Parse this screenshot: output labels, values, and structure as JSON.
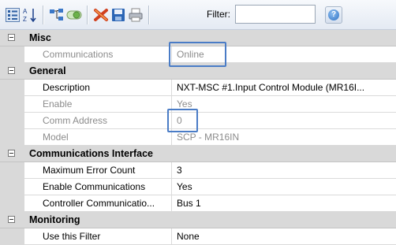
{
  "toolbar": {
    "filter_label": "Filter:",
    "filter_value": "",
    "sort_icon_text": "AZ"
  },
  "grid": {
    "categories": [
      {
        "label": "Misc",
        "properties": [
          {
            "name": "Communications",
            "value": "Online",
            "readonly": true
          }
        ]
      },
      {
        "label": "General",
        "properties": [
          {
            "name": "Description",
            "value": "NXT-MSC #1.Input Control Module (MR16I...",
            "readonly": false
          },
          {
            "name": "Enable",
            "value": "Yes",
            "readonly": true
          },
          {
            "name": "Comm Address",
            "value": "0",
            "readonly": true
          },
          {
            "name": "Model",
            "value": "SCP - MR16IN",
            "readonly": true
          }
        ]
      },
      {
        "label": "Communications Interface",
        "properties": [
          {
            "name": "Maximum Error Count",
            "value": "3",
            "readonly": false
          },
          {
            "name": "Enable Communications",
            "value": "Yes",
            "readonly": false
          },
          {
            "name": "Controller Communicatio...",
            "value": "Bus 1",
            "readonly": false
          }
        ]
      },
      {
        "label": "Monitoring",
        "properties": [
          {
            "name": "Use this Filter",
            "value": "None",
            "readonly": false
          }
        ]
      }
    ]
  },
  "colors": {
    "category_bg": "#d9d9d9",
    "readonly_text": "#8c8c8c",
    "highlight": "#4a7cc6"
  }
}
